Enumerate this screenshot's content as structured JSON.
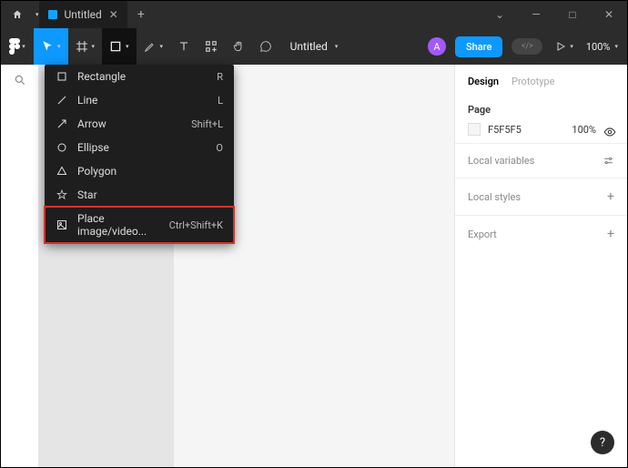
{
  "titlebar": {
    "tab_title": "Untitled"
  },
  "toolbar": {
    "doc_title": "Untitled",
    "avatar_letter": "A",
    "share_label": "Share",
    "zoom_label": "100%"
  },
  "shape_menu": {
    "items": [
      {
        "icon": "rectangle",
        "label": "Rectangle",
        "shortcut": "R"
      },
      {
        "icon": "line",
        "label": "Line",
        "shortcut": "L"
      },
      {
        "icon": "arrow",
        "label": "Arrow",
        "shortcut": "Shift+L"
      },
      {
        "icon": "ellipse",
        "label": "Ellipse",
        "shortcut": "O"
      },
      {
        "icon": "polygon",
        "label": "Polygon",
        "shortcut": ""
      },
      {
        "icon": "star",
        "label": "Star",
        "shortcut": ""
      },
      {
        "icon": "image",
        "label": "Place image/video...",
        "shortcut": "Ctrl+Shift+K",
        "highlight": true
      }
    ]
  },
  "rightpanel": {
    "tabs": {
      "design": "Design",
      "prototype": "Prototype"
    },
    "page": {
      "title": "Page",
      "color": "F5F5F5",
      "opacity": "100%"
    },
    "local_variables": "Local variables",
    "local_styles": "Local styles",
    "export": "Export"
  }
}
